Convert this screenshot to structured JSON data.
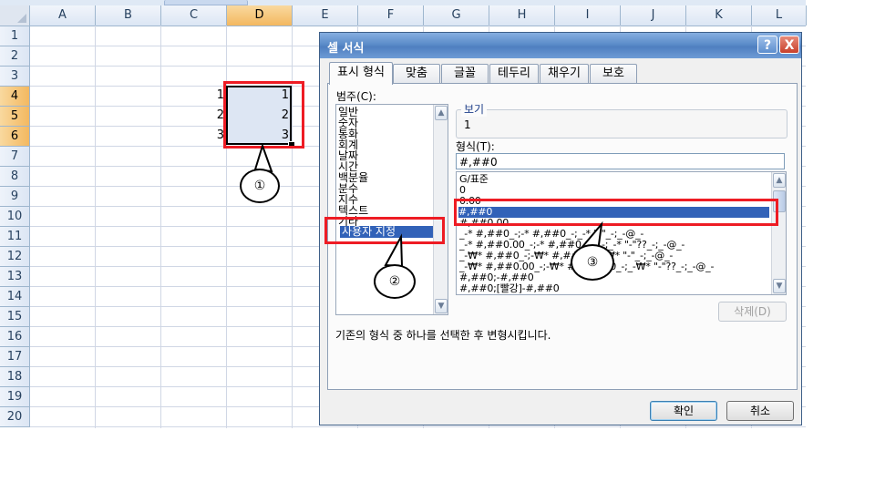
{
  "sheet": {
    "columns": [
      "A",
      "B",
      "C",
      "D",
      "E",
      "F",
      "G",
      "H",
      "I",
      "J",
      "K",
      "L"
    ],
    "selected_column": "D",
    "rows": [
      "1",
      "2",
      "3",
      "4",
      "5",
      "6",
      "7",
      "8",
      "9",
      "10",
      "11",
      "12",
      "13",
      "14",
      "15",
      "16",
      "17",
      "18",
      "19",
      "20"
    ],
    "selected_rows": [
      "4",
      "5",
      "6"
    ],
    "c_values": [
      "1",
      "2",
      "3"
    ],
    "d_values": [
      "1",
      "2",
      "3"
    ]
  },
  "annotations": {
    "callout_1": "①",
    "callout_2": "②",
    "callout_3": "③",
    "color": "#ee1c24"
  },
  "dialog": {
    "title": "셀 서식",
    "help_label": "?",
    "close_label": "X",
    "tabs": [
      "표시 형식",
      "맞춤",
      "글꼴",
      "테두리",
      "채우기",
      "보호"
    ],
    "active_tab": "표시 형식",
    "category_label": "범주(C):",
    "categories": [
      "일반",
      "숫자",
      "통화",
      "회계",
      "날짜",
      "시간",
      "백분율",
      "분수",
      "지수",
      "텍스트",
      "기타",
      "사용자 지정"
    ],
    "selected_category": "사용자 지정",
    "sample_label": "보기",
    "sample_value": "1",
    "type_label": "형식(T):",
    "type_value": "#,##0",
    "formats": [
      "G/표준",
      "0",
      "0.00",
      "#,##0",
      "#,##0.00",
      "_-* #,##0_-;-* #,##0_-;_-* \"-\"_-;_-@_-",
      "_-* #,##0.00_-;-* #,##0.00_-;_-* \"-\"??_-;_-@_-",
      "_-₩* #,##0_-;-₩* #,##0_-;_-₩* \"-\"_-;_-@_-",
      "_-₩* #,##0.00_-;-₩* #,##0.00_-;_-₩* \"-\"??_-;_-@_-",
      "#,##0;-#,##0",
      "#,##0;[빨강]-#,##0"
    ],
    "selected_format": "#,##0",
    "delete_label": "삭제(D)",
    "description": "기존의 형식 중 하나를 선택한 후 변형시킵니다.",
    "ok_label": "확인",
    "cancel_label": "취소"
  }
}
